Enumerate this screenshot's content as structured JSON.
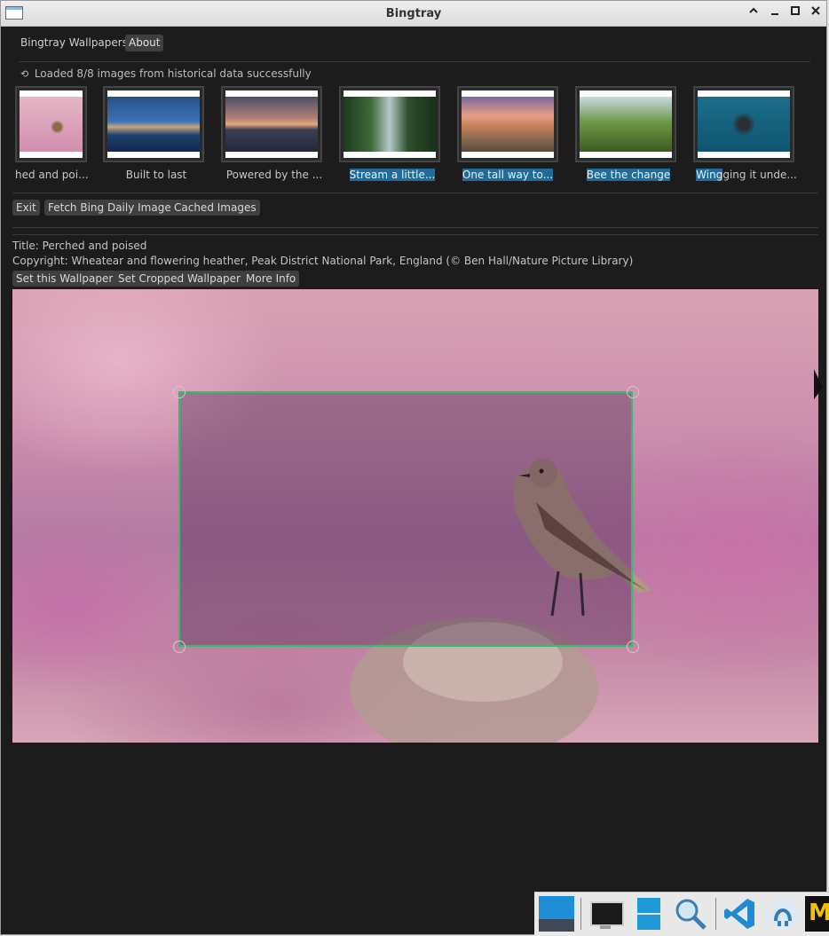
{
  "window": {
    "title": "Bingtray",
    "controls": {
      "collapse": "^",
      "minimize": "_",
      "maximize": "□",
      "close": "×"
    }
  },
  "menu": {
    "app_label": "Bingtray Wallpapers",
    "about_label": "About"
  },
  "status": {
    "icon": "refresh-icon",
    "text": "Loaded 8/8 images from historical data successfully"
  },
  "thumbnails": [
    {
      "caption": "hed and poi...",
      "selected": false
    },
    {
      "caption": "Built to last",
      "selected": false
    },
    {
      "caption": "Powered by the ...",
      "selected": false
    },
    {
      "caption": "Stream a little...",
      "selected": true
    },
    {
      "caption": "One tall way to...",
      "selected": true
    },
    {
      "caption": "Bee the change",
      "selected": true
    },
    {
      "caption_highlight": "Wing",
      "caption_rest": "ging it unde...",
      "selected": "partial"
    }
  ],
  "toolbar": {
    "exit": "Exit",
    "fetch": "Fetch Bing Daily Image",
    "cached": "Cached Images"
  },
  "details": {
    "title": "Title: Perched and poised",
    "copyright": "Copyright: Wheatear and flowering heather, Peak District National Park, England (© Ben Hall/Nature Picture Library)"
  },
  "actions": {
    "set_wallpaper": "Set this Wallpaper",
    "set_cropped": "Set Cropped Wallpaper",
    "more_info": "More Info"
  },
  "colors": {
    "background": "#1c1c1c",
    "button": "#3f3f3f",
    "selection": "#1f6b99",
    "crop": "#2fc06f"
  },
  "dock": {
    "items": [
      "window-icon",
      "monitor-icon",
      "file-cabinet-icon",
      "search-icon",
      "vscode-icon",
      "octopus-icon",
      "app-m-icon"
    ]
  }
}
